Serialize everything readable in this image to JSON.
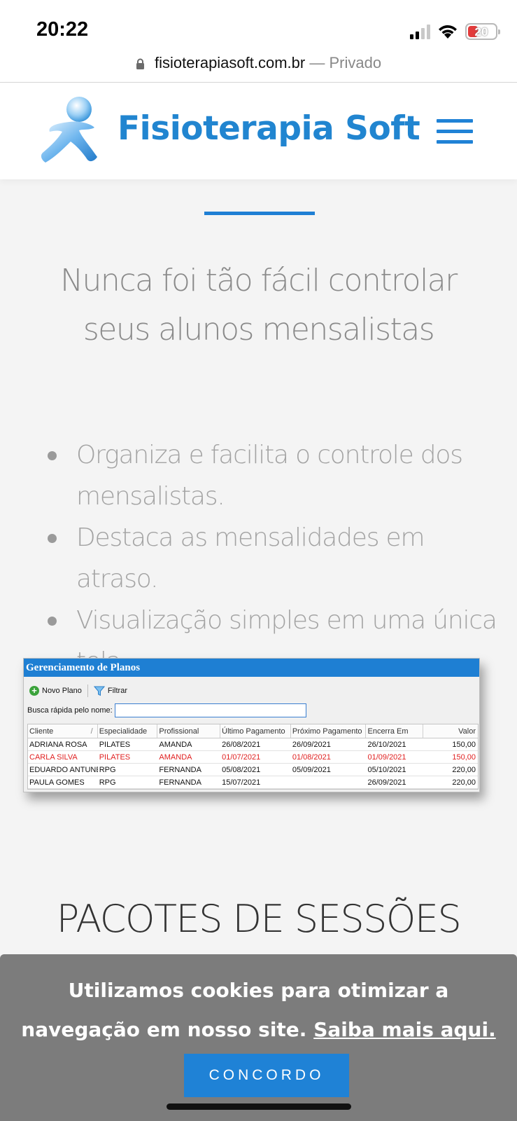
{
  "status_bar": {
    "time": "20:22",
    "battery": "20"
  },
  "browser": {
    "domain": "fisioterapiasoft.com.br",
    "privacy_label": "— Privado"
  },
  "header": {
    "site_name": "Fisioterapia Soft"
  },
  "headline": "Nunca foi tão fácil controlar seus alunos mensalistas",
  "features": [
    "Organiza e facilita o controle dos mensalistas.",
    "Destaca as mensalidades em atraso.",
    "Visualização simples em uma única tela."
  ],
  "app_screenshot": {
    "title": "Gerenciamento de Planos",
    "toolbar": {
      "new_plan": "Novo Plano",
      "filter": "Filtrar"
    },
    "search_label": "Busca rápida pelo nome:",
    "search_value": "",
    "columns": [
      "Cliente",
      "Especialidade",
      "Profissional",
      "Último Pagamento",
      "Próximo Pagamento",
      "Encerra Em",
      "Valor"
    ],
    "rows": [
      [
        "ADRIANA ROSA",
        "PILATES",
        "AMANDA",
        "26/08/2021",
        "26/09/2021",
        "26/10/2021",
        "150,00"
      ],
      [
        "CARLA SILVA",
        "PILATES",
        "AMANDA",
        "01/07/2021",
        "01/08/2021",
        "01/09/2021",
        "150,00"
      ],
      [
        "EDUARDO ANTUNES",
        "RPG",
        "FERNANDA",
        "05/08/2021",
        "05/09/2021",
        "05/10/2021",
        "220,00"
      ],
      [
        "PAULA GOMES",
        "RPG",
        "FERNANDA",
        "15/07/2021",
        "",
        "26/09/2021",
        "220,00"
      ]
    ],
    "late_row_color": "#e02020"
  },
  "section_title": "PACOTES DE SESSÕES",
  "cookie": {
    "text": "Utilizamos cookies para otimizar a navegação em nosso site.",
    "link": "Saiba mais aqui.",
    "button": "CONCORDO"
  },
  "colors": {
    "brand": "#2185d0",
    "banner": "#7c7c7c"
  },
  "icons": [
    "lock-icon",
    "signal-icon",
    "wifi-icon",
    "battery-icon",
    "logo-runner-icon",
    "hamburger-menu-icon",
    "plus-icon",
    "filter-icon"
  ]
}
